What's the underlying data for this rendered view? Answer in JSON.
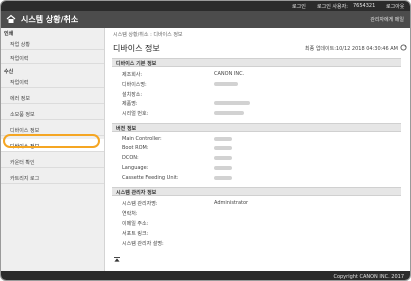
{
  "topbar": {
    "items": [
      "로그인",
      "로그인 사용자:",
      "7654321",
      "로그아웃"
    ]
  },
  "header": {
    "title": "시스템 상황/취소",
    "link": "관리자에게 메일"
  },
  "sidebar": {
    "sections": [
      {
        "label": "인쇄",
        "items": [
          "작업 상황",
          "작업이력"
        ]
      },
      {
        "label": "수신",
        "items": [
          "작업이력",
          "에러 정보",
          "소모품 정보",
          "디바이스 정보",
          "디바이스 정보",
          "카운터 확인",
          "카트리지 로그"
        ]
      }
    ]
  },
  "main": {
    "breadcrumb": "시스템 상황/취소 : 디바이스 정보",
    "title": "디바이스 정보",
    "updated": "최종 업데이트:10/12 2018 04:30:46 AM",
    "sections": [
      {
        "title": "디바이스 기본 정보",
        "rows": [
          {
            "label": "제조회사:",
            "value": "CANON INC."
          },
          {
            "label": "디바이스명:",
            "value": ""
          },
          {
            "label": "설치장소:",
            "value": ""
          },
          {
            "label": "제품명:",
            "value": ""
          },
          {
            "label": "시리얼 번호:",
            "value": ""
          }
        ]
      },
      {
        "title": "버전 정보",
        "rows": [
          {
            "label": "Main Controller:",
            "value": ""
          },
          {
            "label": "Boot ROM:",
            "value": ""
          },
          {
            "label": "DCON:",
            "value": ""
          },
          {
            "label": "Language:",
            "value": ""
          },
          {
            "label": "Cassette Feeding Unit:",
            "value": ""
          }
        ]
      },
      {
        "title": "시스템 관리자 정보",
        "rows": [
          {
            "label": "시스템 관리자명:",
            "value": "Administrator"
          },
          {
            "label": "연락처:",
            "value": ""
          },
          {
            "label": "이메일 주소:",
            "value": ""
          },
          {
            "label": "서포트 링크:",
            "value": ""
          },
          {
            "label": "시스템 관리자 설명:",
            "value": ""
          }
        ]
      }
    ]
  },
  "footer": {
    "copyright": "Copyright CANON INC. 2017"
  },
  "colors": {
    "topbar": "#2b2b2b",
    "header": "#4c4c4c",
    "sidebar": "#efefef",
    "highlight": "#f5a623"
  }
}
